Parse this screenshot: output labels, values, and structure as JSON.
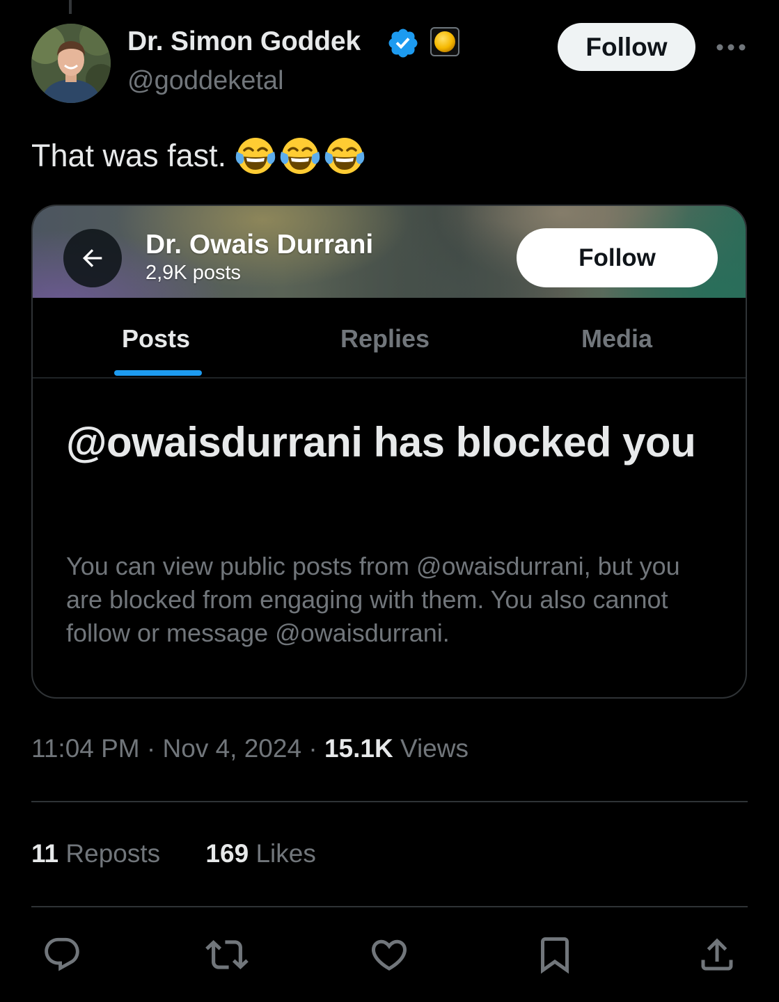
{
  "tweet": {
    "author_name": "Dr. Simon Goddek",
    "author_handle": "@goddeketal",
    "follow_label": "Follow",
    "text": "That was fast.",
    "emoji": "face-with-tears-of-joy",
    "emoji_count": 3,
    "time": "11:04 PM",
    "date": "Nov 4, 2024",
    "separator": "·",
    "views_count": "15.1K",
    "views_label": "Views",
    "reposts_count": "11",
    "reposts_label": "Reposts",
    "likes_count": "169",
    "likes_label": "Likes"
  },
  "embedded_screenshot": {
    "profile_name": "Dr. Owais Durrani",
    "post_count": "2,9K posts",
    "follow_label": "Follow",
    "tabs": [
      {
        "label": "Posts",
        "active": true
      },
      {
        "label": "Replies",
        "active": false
      },
      {
        "label": "Media",
        "active": false
      }
    ],
    "blocked_title": "@owaisdurrani has blocked you",
    "blocked_description": "You can view public posts from @owaisdurrani, but you are blocked from engaging with them. You also cannot follow or message @owaisdurrani."
  },
  "actions": [
    "reply-icon",
    "repost-icon",
    "like-icon",
    "bookmark-icon",
    "share-icon"
  ],
  "colors": {
    "background": "#000000",
    "text_primary": "#e7e9ea",
    "text_secondary": "#71767b",
    "accent_blue": "#1d9bf0",
    "divider": "#2f3336"
  }
}
